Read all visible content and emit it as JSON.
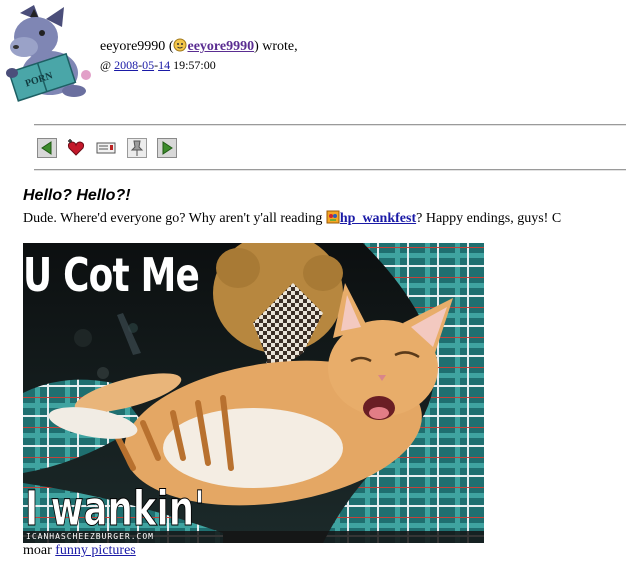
{
  "header": {
    "username": "eeyore9990",
    "open_paren": " (",
    "user_link": "eeyore9990",
    "wrote": ") wrote,",
    "at": "@ ",
    "date_year": "2008",
    "date_month": "05",
    "date_day": "14",
    "time": "19:57:00",
    "userpic_book_text": "PORN"
  },
  "toolbar": {
    "icons": [
      "prev-entry-icon",
      "add-memory-icon",
      "tell-a-friend-icon",
      "track-icon",
      "next-entry-icon"
    ]
  },
  "entry": {
    "subject": "Hello? Hello?!",
    "body_before": "Dude. Where'd everyone go? Why aren't y'all reading ",
    "community_link": "hp_wankfest",
    "body_after": "? Happy endings, guys! C"
  },
  "macro": {
    "top_caption": "U Cot Me",
    "bottom_caption": "I wankin'",
    "watermark": "ICANHASCHEEZBURGER.COM"
  },
  "footer": {
    "moar": "moar ",
    "link": "funny pictures"
  },
  "colors": {
    "link": "#1a1aa6",
    "user_link": "#5a2d91",
    "separator": "#9a9a9a"
  }
}
